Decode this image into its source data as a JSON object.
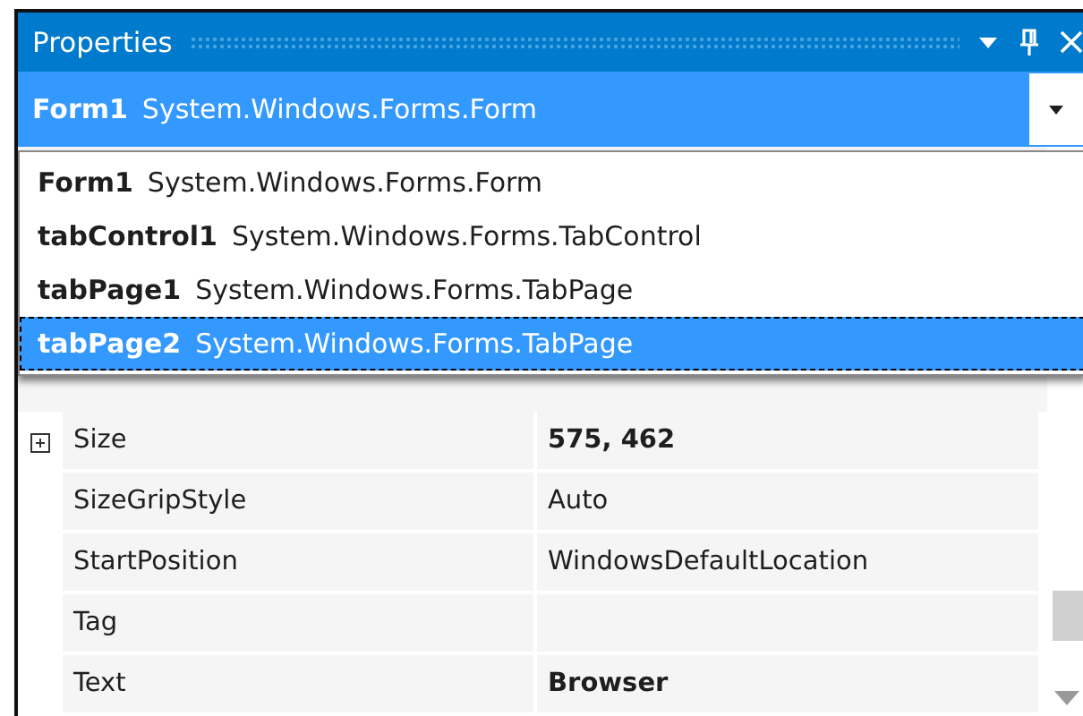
{
  "window": {
    "title": "Properties"
  },
  "object_selector": {
    "name": "Form1",
    "type": "System.Windows.Forms.Form"
  },
  "dropdown": {
    "items": [
      {
        "name": "Form1",
        "type": "System.Windows.Forms.Form",
        "selected": false
      },
      {
        "name": "tabControl1",
        "type": "System.Windows.Forms.TabControl",
        "selected": false
      },
      {
        "name": "tabPage1",
        "type": "System.Windows.Forms.TabPage",
        "selected": false
      },
      {
        "name": "tabPage2",
        "type": "System.Windows.Forms.TabPage",
        "selected": true
      }
    ]
  },
  "properties": [
    {
      "name": "Size",
      "value": "575, 462",
      "modified": true,
      "expandable": true
    },
    {
      "name": "SizeGripStyle",
      "value": "Auto",
      "modified": false,
      "expandable": false
    },
    {
      "name": "StartPosition",
      "value": "WindowsDefaultLocation",
      "modified": false,
      "expandable": false
    },
    {
      "name": "Tag",
      "expandable": false
    },
    {
      "name": "Text",
      "value": "Browser",
      "modified": true,
      "expandable": false
    }
  ]
}
